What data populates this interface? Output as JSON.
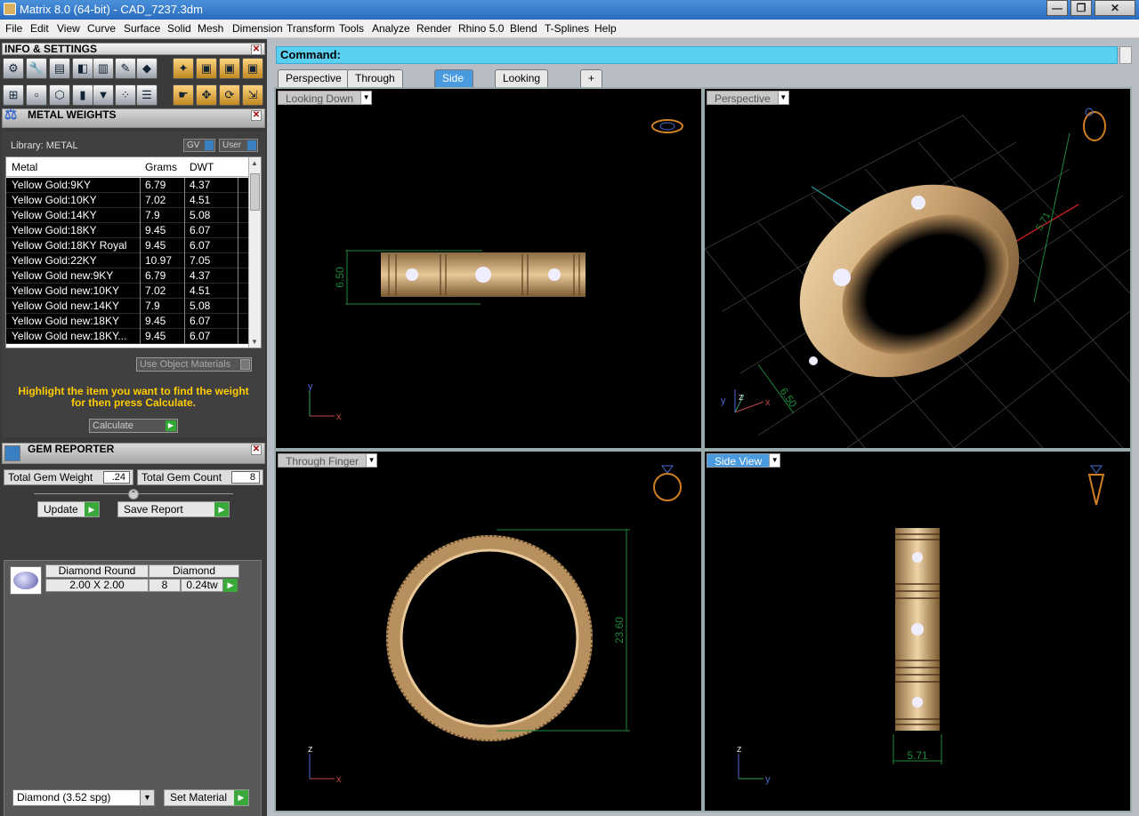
{
  "window": {
    "title": "Matrix 8.0 (64-bit) - CAD_7237.3dm",
    "min": "—",
    "max": "❐",
    "close": "✕"
  },
  "menu": [
    "File",
    "Edit",
    "View",
    "Curve",
    "Surface",
    "Solid",
    "Mesh",
    "Dimension",
    "Transform",
    "Tools",
    "Analyze",
    "Render",
    "Rhino 5.0",
    "Blend",
    "T-Splines",
    "Help"
  ],
  "info_panel": {
    "title": "INFO & SETTINGS"
  },
  "metal_weights": {
    "title": "METAL WEIGHTS",
    "library_label": "Library: METAL",
    "toggle_gv": "GV",
    "toggle_user": "User",
    "columns": [
      "Metal",
      "Grams",
      "DWT"
    ],
    "rows": [
      {
        "metal": "Yellow Gold:9KY",
        "grams": "6.79",
        "dwt": "4.37"
      },
      {
        "metal": "Yellow Gold:10KY",
        "grams": "7.02",
        "dwt": "4.51"
      },
      {
        "metal": "Yellow Gold:14KY",
        "grams": "7.9",
        "dwt": "5.08"
      },
      {
        "metal": "Yellow Gold:18KY",
        "grams": "9.45",
        "dwt": "6.07"
      },
      {
        "metal": "Yellow Gold:18KY Royal",
        "grams": "9.45",
        "dwt": "6.07"
      },
      {
        "metal": "Yellow Gold:22KY",
        "grams": "10.97",
        "dwt": "7.05"
      },
      {
        "metal": "Yellow Gold new:9KY",
        "grams": "6.79",
        "dwt": "4.37"
      },
      {
        "metal": "Yellow Gold new:10KY",
        "grams": "7.02",
        "dwt": "4.51"
      },
      {
        "metal": "Yellow Gold new:14KY",
        "grams": "7.9",
        "dwt": "5.08"
      },
      {
        "metal": "Yellow Gold new:18KY",
        "grams": "9.45",
        "dwt": "6.07"
      },
      {
        "metal": "Yellow Gold new:18KY...",
        "grams": "9.45",
        "dwt": "6.07"
      }
    ],
    "use_object_materials": "Use Object Materials",
    "hint_line1": "Highlight the item you want to find the weight",
    "hint_line2": "for then press Calculate.",
    "calculate": "Calculate"
  },
  "gem_reporter": {
    "title": "GEM REPORTER",
    "total_weight_label": "Total Gem Weight",
    "total_weight_value": ".24",
    "total_count_label": "Total Gem Count",
    "total_count_value": "8",
    "update": "Update",
    "save_report": "Save Report",
    "gem": {
      "shape": "Diamond Round",
      "material": "Diamond",
      "size": "2.00 X 2.00",
      "count": "8",
      "weight": "0.24tw"
    }
  },
  "material_select": "Diamond     (3.52 spg)",
  "set_material": "Set Material",
  "command_label": "Command:",
  "tabs": [
    "Perspective",
    "Through Finger",
    "Side View",
    "Looking Down",
    "+"
  ],
  "viewports": {
    "top_left": {
      "label": "Looking Down",
      "dim": "6.50"
    },
    "top_right": {
      "label": "Perspective",
      "dim": "6.50",
      "dim2": "5.71"
    },
    "bottom_left": {
      "label": "Through Finger",
      "dim": "23.60"
    },
    "bottom_right": {
      "label": "Side View",
      "dim": "5.71"
    }
  },
  "axes": {
    "x": "x",
    "y": "y",
    "z": "z"
  }
}
